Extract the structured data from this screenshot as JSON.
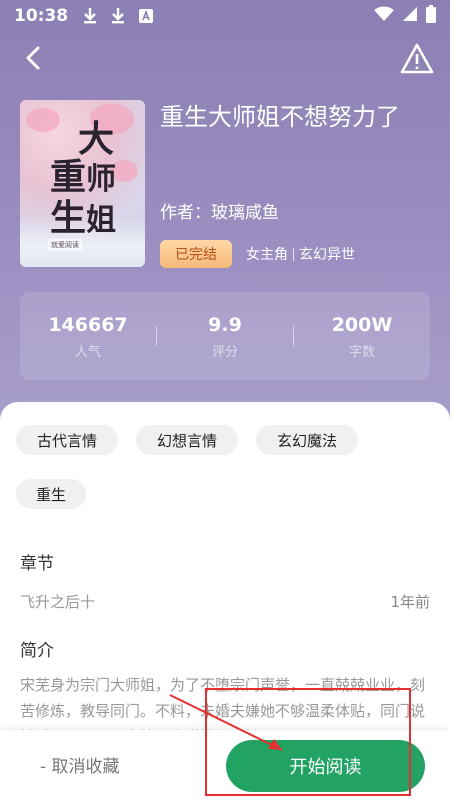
{
  "status_bar": {
    "time": "10:38",
    "icons": [
      "download-icon",
      "download-icon",
      "a-icon"
    ],
    "right_icons": [
      "wifi-icon",
      "signal-icon",
      "battery-icon"
    ]
  },
  "toolbar": {
    "back_icon": "chevron-left-icon",
    "report_icon": "warning-icon"
  },
  "book": {
    "title": "重生大师姐不想努力了",
    "author": "作者：玻璃咸鱼",
    "status": "已完结",
    "genres": [
      "女主角",
      "玄幻异世"
    ],
    "cover": {
      "title_art": "大师\n重生姐",
      "publisher": "就爱阅读"
    }
  },
  "stats": [
    {
      "value": "146667",
      "label": "人气"
    },
    {
      "value": "9.9",
      "label": "评分"
    },
    {
      "value": "200W",
      "label": "字数"
    }
  ],
  "tags": [
    "古代言情",
    "幻想言情",
    "玄幻魔法",
    "重生"
  ],
  "chapter": {
    "section_title": "章节",
    "latest": "飞升之后十",
    "time": "1年前"
  },
  "intro": {
    "section_title": "简介",
    "text": "宋芜身为宗门大师姐，为了不堕宗门声誉，一直兢兢业业，刻苦修炼，教导同门。不料，未婚夫嫌她不够温柔体贴，同门说她过于严厉不通人情，连掌门都说她……"
  },
  "actions": {
    "cancel_label": "- 取消收藏",
    "start_label": "开始阅读"
  },
  "colors": {
    "hero": "#9c90c2",
    "accent": "#22a363",
    "badge": "#f6b979",
    "annotation": "#e53030"
  }
}
